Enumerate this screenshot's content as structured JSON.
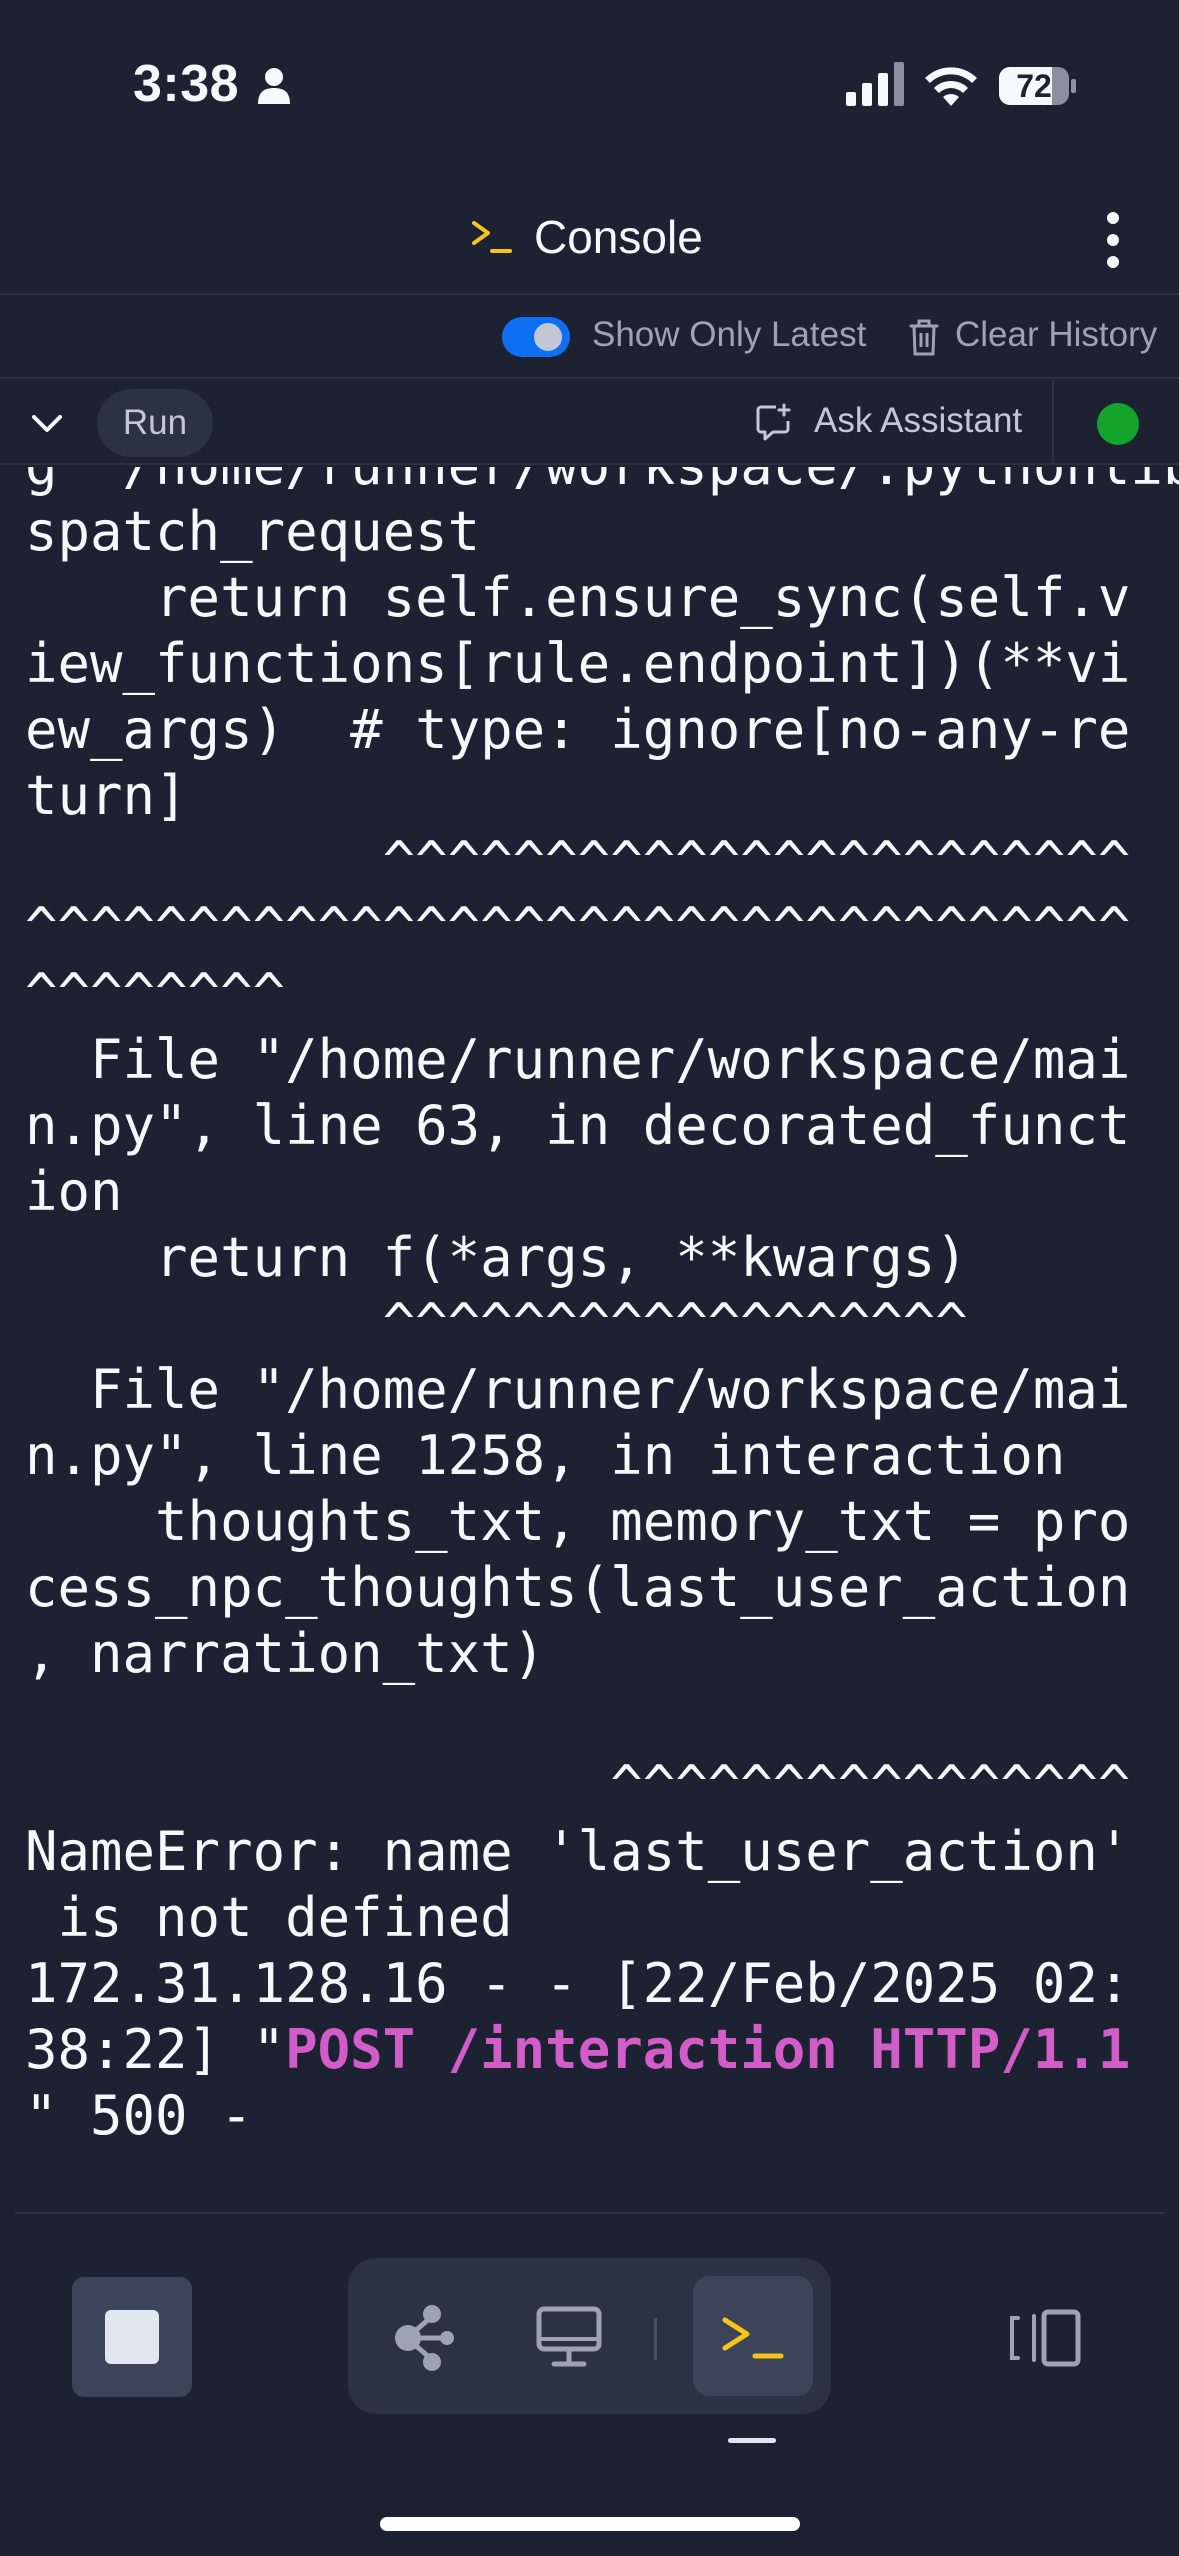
{
  "status_bar": {
    "time": "3:38",
    "battery": "72"
  },
  "header": {
    "title": "Console"
  },
  "toolbar": {
    "show_only_latest": "Show Only Latest",
    "show_only_latest_on": true,
    "clear_history": "Clear History",
    "run": "Run",
    "ask_assistant": "Ask Assistant"
  },
  "colors": {
    "background": "#1c2232",
    "accent": "#0f6ff2",
    "status_ok": "#14a42c",
    "highlight": "#d25cc8",
    "prompt_icon": "#f5c518"
  },
  "console": {
    "before_highlight": "g \"/home/runner/workspace/.pythonlibs\nspatch_request\n    return self.ensure_sync(self.v\niew_functions[rule.endpoint])(**vi\new_args)  # type: ignore[no-any-re\nturn]\n           ^^^^^^^^^^^^^^^^^^^^^^^\n^^^^^^^^^^^^^^^^^^^^^^^^^^^^^^^^^^\n^^^^^^^^\n  File \"/home/runner/workspace/mai\nn.py\", line 63, in decorated_funct\nion\n    return f(*args, **kwargs)\n           ^^^^^^^^^^^^^^^^^^\n  File \"/home/runner/workspace/mai\nn.py\", line 1258, in interaction\n    thoughts_txt, memory_txt = pro\ncess_npc_thoughts(last_user_action\n, narration_txt)\n\n                  ^^^^^^^^^^^^^^^^\nNameError: name 'last_user_action'\n is not defined\n172.31.128.16 - - [22/Feb/2025 02:\n38:22] \"",
    "highlight": "POST /interaction HTTP/1.1",
    "after_highlight": "\n\" 500 -"
  },
  "icons": {
    "person": "person-icon",
    "signal": "cellular-signal-icon",
    "wifi": "wifi-icon",
    "battery": "battery-icon",
    "console": "terminal-prompt-icon",
    "menu": "kebab-menu-icon",
    "trash": "trash-icon",
    "chevron": "chevron-down-icon",
    "assistant": "chat-edit-icon",
    "stop": "stop-icon",
    "git": "git-branch-icon",
    "monitor": "monitor-icon",
    "panes": "panes-icon"
  }
}
